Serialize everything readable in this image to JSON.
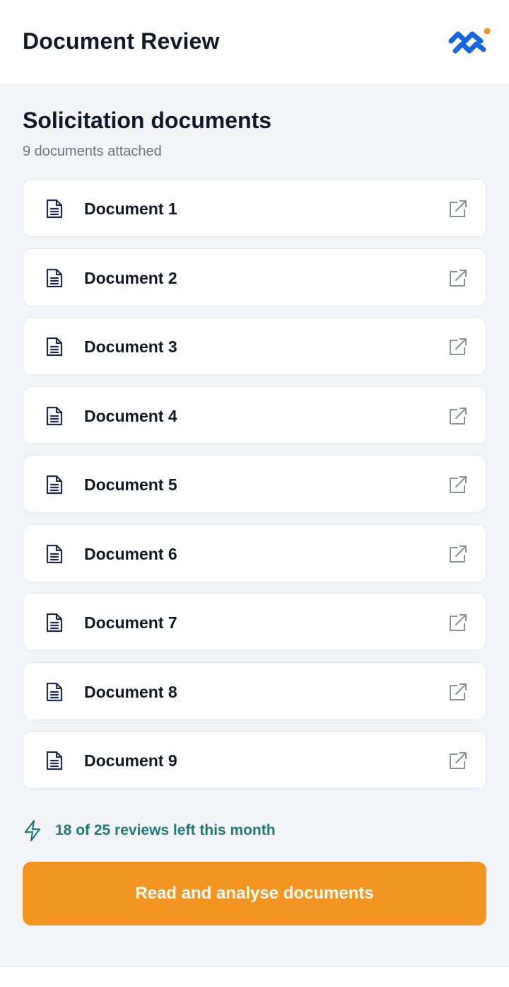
{
  "header": {
    "title": "Document Review",
    "logo_icon": "brand-wave-logo",
    "brand_blue": "#1565E0",
    "brand_orange": "#F39521"
  },
  "section": {
    "title": "Solicitation documents",
    "subtitle": "9 documents attached"
  },
  "documents": [
    {
      "label": "Document 1",
      "icon": "file-text-icon",
      "action_icon": "external-link-icon"
    },
    {
      "label": "Document 2",
      "icon": "file-text-icon",
      "action_icon": "external-link-icon"
    },
    {
      "label": "Document 3",
      "icon": "file-text-icon",
      "action_icon": "external-link-icon"
    },
    {
      "label": "Document 4",
      "icon": "file-text-icon",
      "action_icon": "external-link-icon"
    },
    {
      "label": "Document 5",
      "icon": "file-text-icon",
      "action_icon": "external-link-icon"
    },
    {
      "label": "Document 6",
      "icon": "file-text-icon",
      "action_icon": "external-link-icon"
    },
    {
      "label": "Document 7",
      "icon": "file-text-icon",
      "action_icon": "external-link-icon"
    },
    {
      "label": "Document 8",
      "icon": "file-text-icon",
      "action_icon": "external-link-icon"
    },
    {
      "label": "Document 9",
      "icon": "file-text-icon",
      "action_icon": "external-link-icon"
    }
  ],
  "usage": {
    "text": "18 of 25 reviews left this month",
    "icon": "lightning-bolt-icon",
    "color": "#1F7A78"
  },
  "cta": {
    "label": "Read and analyse documents",
    "color": "#F39521"
  }
}
